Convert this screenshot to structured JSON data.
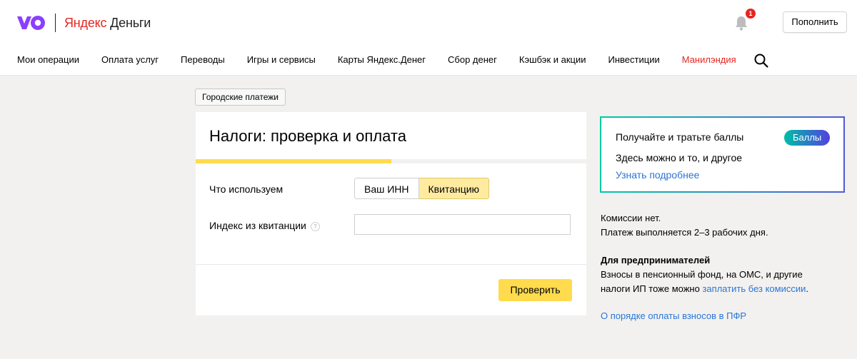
{
  "header": {
    "brand_part1": "Яндекс",
    "brand_part2": "Деньги",
    "notification_count": "1",
    "topup_label": "Пополнить"
  },
  "nav": {
    "items": [
      "Мои операции",
      "Оплата услуг",
      "Переводы",
      "Игры и сервисы",
      "Карты Яндекс.Денег",
      "Сбор денег",
      "Кэшбэк и акции",
      "Инвестиции",
      "Манилэндия"
    ]
  },
  "breadcrumb": {
    "category": "Городские платежи"
  },
  "form": {
    "title": "Налоги: проверка и оплата",
    "progress": 0.5,
    "method_label": "Что используем",
    "method_options": [
      "Ваш ИНН",
      "Квитанцию"
    ],
    "selected_method": "Квитанцию",
    "index_label": "Индекс из квитанции",
    "help_glyph": "?",
    "index_value": "",
    "submit_label": "Проверить"
  },
  "promo": {
    "title": "Получайте и тратьте баллы",
    "badge": "Баллы",
    "subtitle": "Здесь можно и то, и другое",
    "link": "Узнать подробнее"
  },
  "info": {
    "commission": "Комиссии нет.",
    "timing": "Платеж выполняется 2–3 рабочих дня.",
    "entrepreneurs_title": "Для предпринимателей",
    "entrepreneurs_text_1": "Взносы в пенсионный фонд, на ОМС, и другие",
    "entrepreneurs_text_2": "налоги ИП тоже можно ",
    "entrepreneurs_link": "заплатить без комиссии",
    "entrepreneurs_end": ".",
    "pfr_link": "О порядке оплаты взносов в ПФР"
  },
  "colors": {
    "accent_red": "#e52620",
    "brand_purple": "#8b3ffd",
    "yellow": "#ffdb4d",
    "link_blue": "#2a75d4"
  }
}
